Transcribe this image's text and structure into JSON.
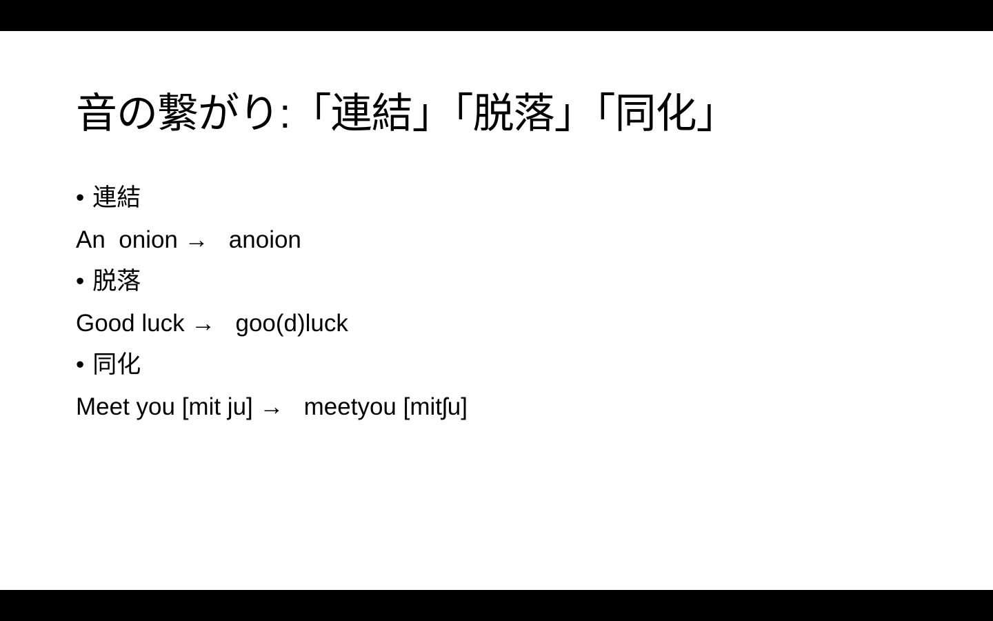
{
  "slide": {
    "title": "音の繋がり:「連結」「脱落」「同化」",
    "items": [
      {
        "bullet": "•",
        "heading": "連結",
        "example": "An  onion →   anoion"
      },
      {
        "bullet": "•",
        "heading": "脱落",
        "example": "Good luck →   goo(d)luck"
      },
      {
        "bullet": "•",
        "heading": "同化",
        "example": "Meet you [mit ju] →   meetyou [mitʃu]"
      }
    ]
  }
}
